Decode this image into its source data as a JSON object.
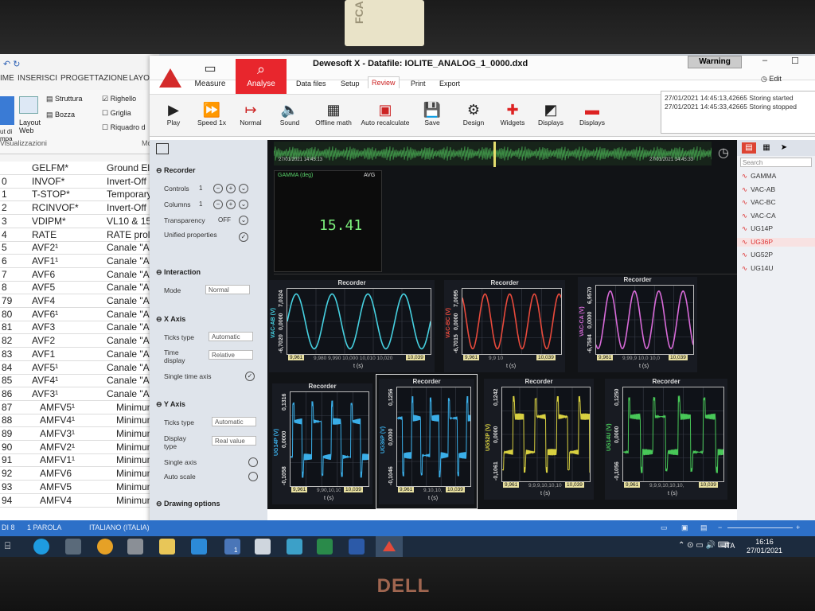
{
  "monitor": {
    "brand": "DELL",
    "sticker_text": "FCA EMEA"
  },
  "word": {
    "tabs": [
      "IME",
      "INSERISCI",
      "PROGETTAZIONE",
      "LAYOU"
    ],
    "ribbon": {
      "struttura": "Struttura",
      "bozza": "Bozza",
      "layout_web": "Layout Web",
      "righello": "Righello",
      "griglia": "Griglia",
      "riquadro": "Riquadro d",
      "visualizzazioni": "Visualizzazioni",
      "mo": "Mo",
      "lut": "ut di mpa"
    },
    "rows": [
      {
        "n": "",
        "code": "GELFM*",
        "desc": "Ground El"
      },
      {
        "n": "0",
        "code": "INVOF*",
        "desc": "Invert-Off"
      },
      {
        "n": "1",
        "code": "T-STOP*",
        "desc": "Temporary"
      },
      {
        "n": "2",
        "code": "RCINVOF*",
        "desc": "Invert-Off r"
      },
      {
        "n": "3",
        "code": "VDIPM*",
        "desc": "VL10 & 15"
      },
      {
        "n": "4",
        "code": "RATE",
        "desc": "RATE prol"
      },
      {
        "n": "5",
        "code": "AVF2¹",
        "desc": "Canale \"A"
      },
      {
        "n": "6",
        "code": "AVF1¹",
        "desc": "Canale \"A"
      },
      {
        "n": "7",
        "code": "AVF6",
        "desc": "Canale \"A"
      },
      {
        "n": "8",
        "code": "AVF5",
        "desc": "Canale \"A"
      },
      {
        "n": "79",
        "code": "AVF4",
        "desc": "Canale \"A"
      },
      {
        "n": "80",
        "code": "AVF6¹",
        "desc": "Canale \"A"
      },
      {
        "n": "81",
        "code": "AVF3",
        "desc": "Canale \"A"
      },
      {
        "n": "82",
        "code": "AVF2",
        "desc": "Canale \"A"
      },
      {
        "n": "83",
        "code": "AVF1",
        "desc": "Canale \"A"
      },
      {
        "n": "84",
        "code": "AVF5¹",
        "desc": "Canale \"A"
      },
      {
        "n": "85",
        "code": "AVF4¹",
        "desc": "Canale \"A"
      },
      {
        "n": "86",
        "code": "AVF3¹",
        "desc": "Canale \"A"
      },
      {
        "n": "87",
        "code": "AMFV5¹",
        "desc": "Minimum F"
      },
      {
        "n": "88",
        "code": "AMFV4¹",
        "desc": "Minimum F"
      },
      {
        "n": "89",
        "code": "AMFV3¹",
        "desc": "Minimum F"
      },
      {
        "n": "90",
        "code": "AMFV2¹",
        "desc": "Minimum F"
      },
      {
        "n": "91",
        "code": "AMFV1¹",
        "desc": "Minimum F"
      },
      {
        "n": "92",
        "code": "AMFV6",
        "desc": "Minimum F"
      },
      {
        "n": "93",
        "code": "AMFV5",
        "desc": "Minimum F"
      },
      {
        "n": "94",
        "code": "AMFV4",
        "desc": "Minimum F"
      }
    ]
  },
  "dewesoft": {
    "title": "Dewesoft X - Datafile: IOLITE_ANALOG_1_0000.dxd",
    "measure": "Measure",
    "analyse": "Analyse",
    "menus": [
      "Data files",
      "Setup",
      "Review",
      "Print",
      "Export"
    ],
    "warning": "Warning",
    "edit": "Edit",
    "toolbar": [
      {
        "icon": "▶",
        "label": "Play"
      },
      {
        "icon": "⏩",
        "label": "Speed 1x"
      },
      {
        "icon": "↦",
        "label": "Normal"
      },
      {
        "icon": "🔈",
        "label": "Sound"
      },
      {
        "icon": "▦",
        "label": "Offline math"
      },
      {
        "icon": "▣",
        "label": "Auto recalculate"
      },
      {
        "icon": "💾",
        "label": "Save"
      },
      {
        "icon": "⚙",
        "label": "Design"
      },
      {
        "icon": "✚",
        "label": "Widgets"
      },
      {
        "icon": "◩",
        "label": "Displays"
      },
      {
        "icon": "▬",
        "label": "Displays"
      }
    ],
    "log": [
      {
        "time": "27/01/2021 14:45:13,42665",
        "msg": "Storing started"
      },
      {
        "time": "27/01/2021 14:45:33,42665",
        "msg": "Storing stopped"
      }
    ],
    "panel": {
      "recorder": "Recorder",
      "controls": {
        "label": "Controls",
        "value": "1"
      },
      "columns": {
        "label": "Columns",
        "value": "1"
      },
      "transparency": {
        "label": "Transparency",
        "value": "OFF"
      },
      "unified": "Unified properties",
      "interaction": "Interaction",
      "mode": {
        "label": "Mode",
        "value": "Normal"
      },
      "xaxis": "X Axis",
      "ticks_type_x": {
        "label": "Ticks type",
        "value": "Automatic"
      },
      "time_display": {
        "label": "Time display",
        "value": "Relative"
      },
      "single_time": "Single time axis",
      "yaxis": "Y Axis",
      "ticks_type_y": {
        "label": "Ticks type",
        "value": "Automatic"
      },
      "display_type": {
        "label": "Display type",
        "value": "Real value"
      },
      "single_axis": "Single axis",
      "auto_scale": "Auto scale",
      "drawing": "Drawing options"
    },
    "overview": {
      "t_left": "27/01/2021 14:45:13",
      "t_right": "27/01/2021 14:45:33"
    },
    "gamma": {
      "label": "GAMMA (deg)",
      "avg": "AVG",
      "value": "15.41"
    },
    "charts": [
      {
        "title": "Recorder",
        "ylabel": "VAC-AB (V)",
        "ymax": "7,0324",
        "ymin": "-6,7020",
        "ymid": "0,0000",
        "xmin": "9,961",
        "xmax": "10,039",
        "xticks": "9,980 9,990 10,000 10,010 10,020",
        "xlabel": "t (s)",
        "color": "#46d0e0"
      },
      {
        "title": "Recorder",
        "ylabel": "VAC-BC (V)",
        "ymax": "7,0095",
        "ymin": "-6,7015",
        "ymid": "0,0000",
        "xmin": "9,961",
        "xmax": "10,039",
        "xticks": "9,9 10",
        "xlabel": "t (s)",
        "color": "#e84a3c"
      },
      {
        "title": "Recorder",
        "ylabel": "VAC-CA (V)",
        "ymax": "6,9570",
        "ymin": "-6,7584",
        "ymid": "0,0000",
        "xmin": "9,961",
        "xmax": "10,039",
        "xticks": "9,99,9 10,0 10,0",
        "xlabel": "t (s)",
        "color": "#d76ad8"
      },
      {
        "title": "Recorder",
        "ylabel": "UG14P (V)",
        "ymax": "0,1316",
        "ymin": "-0,1058",
        "ymid": "0,0000",
        "xmin": "9,961",
        "xmax": "10,039",
        "xticks": "9,90,10,10,",
        "xlabel": "t (s)",
        "color": "#3aaee8"
      },
      {
        "title": "Recorder",
        "ylabel": "UG36P (V)",
        "ymax": "0,1256",
        "ymin": "-0,1046",
        "ymid": "0,0000",
        "xmin": "9,961",
        "xmax": "10,039",
        "xticks": "9,10,10,10,",
        "xlabel": "t (s)",
        "color": "#3aaee8"
      },
      {
        "title": "Recorder",
        "ylabel": "UG52P (V)",
        "ymax": "0,1242",
        "ymin": "-0,1061",
        "ymid": "0,0000",
        "xmin": "9,961",
        "xmax": "10,039",
        "xticks": "9,9,9,10,10,10,",
        "xlabel": "t (s)",
        "color": "#d8d040"
      },
      {
        "title": "Recorder",
        "ylabel": "UG14U (V)",
        "ymax": "0,1250",
        "ymin": "-0,1056",
        "ymid": "0,0000",
        "xmin": "9,961",
        "xmax": "10,039",
        "xticks": "9,9,9,10,10,10,",
        "xlabel": "t (s)",
        "color": "#48c858"
      }
    ],
    "search_placeholder": "Search",
    "channels": [
      "GAMMA",
      "VAC-AB",
      "VAC-BC",
      "VAC-CA",
      "UG14P",
      "UG36P",
      "UG52P",
      "UG14U"
    ]
  },
  "statusbar": {
    "words": "DI 8",
    "count": "1 PAROLA",
    "lang": "ITALIANO (ITALIA)"
  },
  "taskbar": {
    "lang": "ITA",
    "time": "16:16",
    "date": "27/01/2021",
    "badge": "1"
  }
}
